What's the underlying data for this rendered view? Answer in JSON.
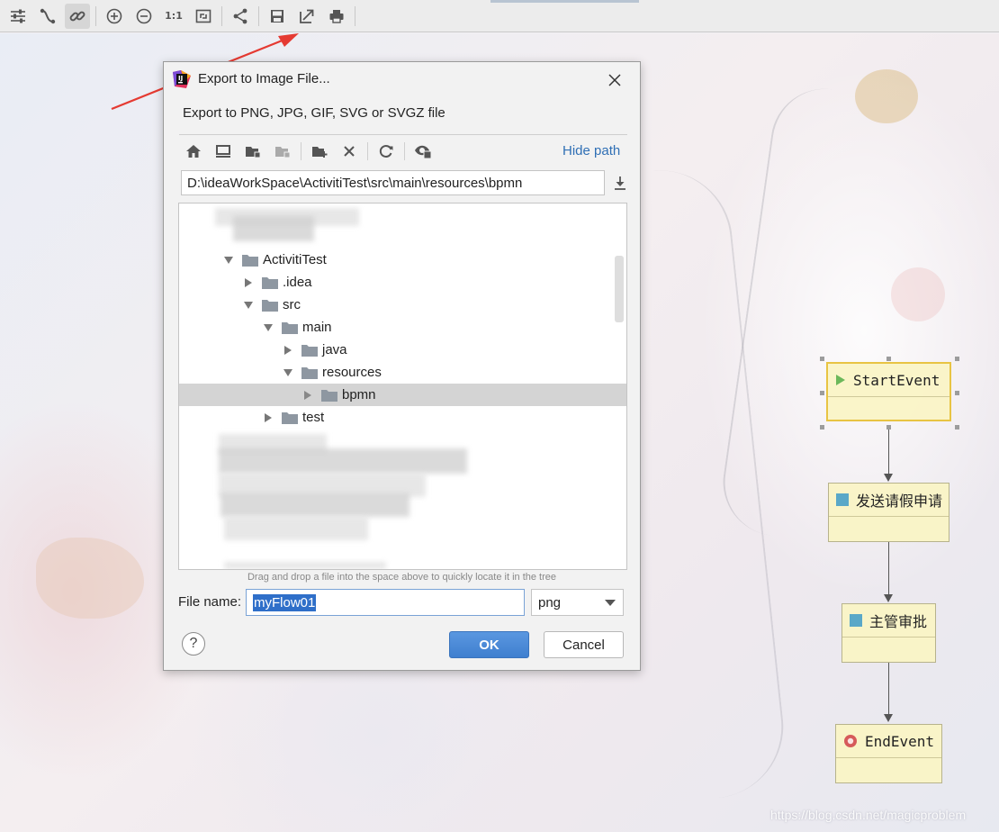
{
  "toolbar": {
    "buttons": [
      "settings-icon",
      "edge-icon",
      "link-icon",
      "zoom-in-icon",
      "zoom-out-icon",
      "actual-size",
      "fit-icon",
      "layout-icon",
      "save-icon",
      "export-icon",
      "print-icon"
    ],
    "actual_size_label": "1:1"
  },
  "dialog": {
    "title": "Export to Image File...",
    "subtitle": "Export to PNG, JPG, GIF, SVG or SVGZ file",
    "hide_path": "Hide path",
    "path": "D:\\ideaWorkSpace\\ActivitiTest\\src\\main\\resources\\bpmn",
    "tree": [
      {
        "label": "ActivitiTest",
        "expanded": true
      },
      {
        "label": ".idea",
        "expanded": false
      },
      {
        "label": "src",
        "expanded": true
      },
      {
        "label": "main",
        "expanded": true
      },
      {
        "label": "java",
        "expanded": false
      },
      {
        "label": "resources",
        "expanded": true
      },
      {
        "label": "bpmn",
        "expanded": false,
        "selected": true
      },
      {
        "label": "test",
        "expanded": false
      }
    ],
    "drag_hint": "Drag and drop a file into the space above to quickly locate it in the tree",
    "file_name_label": "File name:",
    "file_name": "myFlow01",
    "format": "png",
    "help": "?",
    "ok": "OK",
    "cancel": "Cancel"
  },
  "diagram": {
    "nodes": [
      {
        "id": "start",
        "label": "StartEvent",
        "icon": "play-icon",
        "color": "#6cb85a"
      },
      {
        "id": "task1",
        "label": "发送请假申请",
        "icon": "task-icon",
        "color": "#5aa8c8"
      },
      {
        "id": "task2",
        "label": "主管审批",
        "icon": "task-icon",
        "color": "#5aa8c8"
      },
      {
        "id": "end",
        "label": "EndEvent",
        "icon": "end-icon",
        "color": "#d65a5a"
      }
    ]
  },
  "watermark": "https://blog.csdn.net/magicproblem",
  "colors": {
    "accent": "#3f7fcf",
    "link": "#2f6fb5",
    "selection": "#2f6fc9",
    "arrow": "#e53a32"
  }
}
